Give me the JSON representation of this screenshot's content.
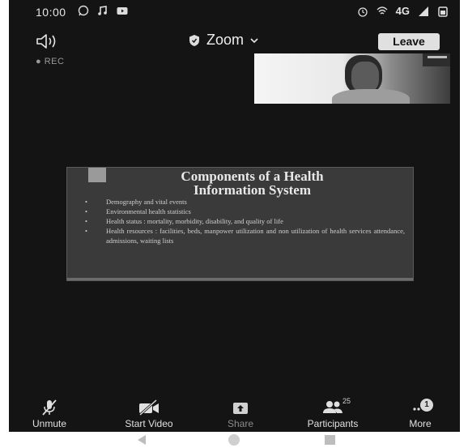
{
  "status_bar": {
    "time": "10:00",
    "network": "4G",
    "icons": [
      "whatsapp-icon",
      "music-icon",
      "youtube-icon",
      "alarm-icon",
      "wifi-calling-icon",
      "signal-icon",
      "battery-icon"
    ]
  },
  "top_bar": {
    "meeting_title": "Zoom",
    "leave_label": "Leave",
    "speaker_icon": "speaker-icon",
    "shield_icon": "shield-icon"
  },
  "recording": {
    "label": "REC"
  },
  "shared_slide": {
    "title_line1": "Components of a Health",
    "title_line2": "Information System",
    "bullets": [
      "Demography and vital events",
      "Environmental health statistics",
      "Health status : mortality, morbidity, disability, and quality of life",
      "Health resources : facilities, beds, manpower utilization and non utilization of health services attendance, admissions, waiting lists"
    ]
  },
  "toolbar": {
    "unmute_label": "Unmute",
    "start_video_label": "Start Video",
    "share_label": "Share",
    "participants_label": "Participants",
    "participants_count": "25",
    "more_label": "More",
    "more_badge": "1"
  },
  "colors": {
    "background": "#141414",
    "leave_button": "#e0e0e0",
    "text": "#e0e0e0"
  }
}
